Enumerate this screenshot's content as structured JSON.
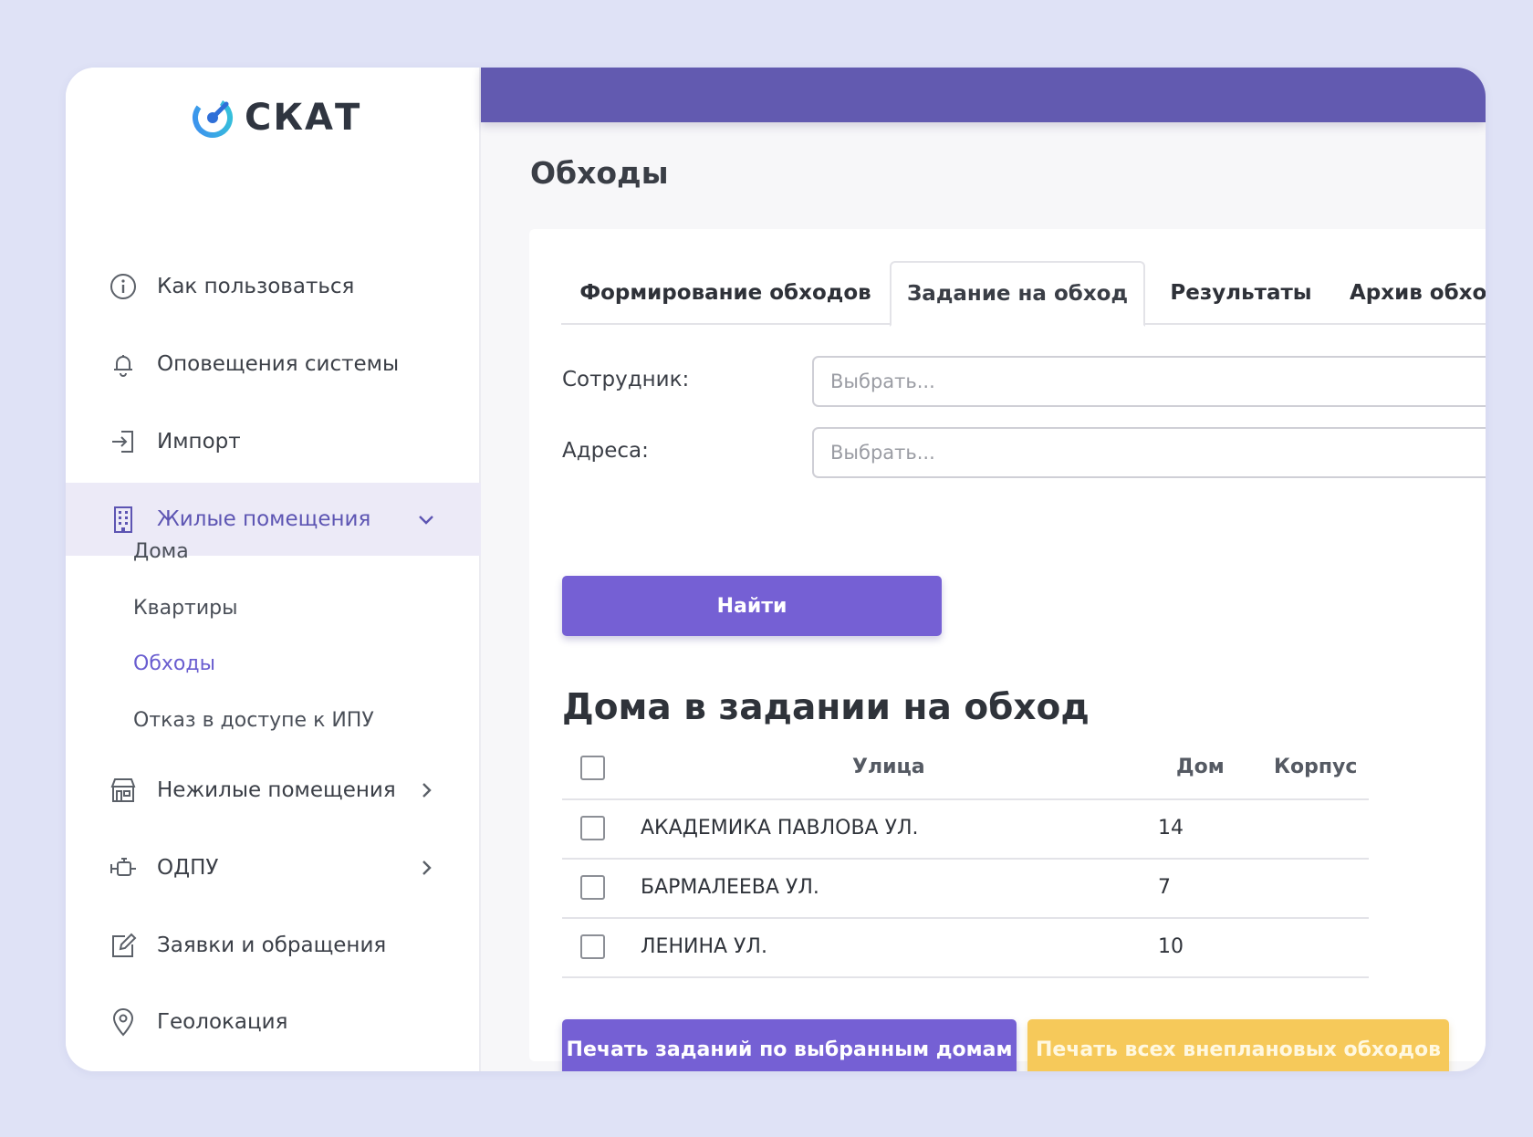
{
  "app": {
    "logo_text": "СКАТ"
  },
  "sidebar": {
    "items": [
      {
        "label": "Как пользоваться"
      },
      {
        "label": "Оповещения системы"
      },
      {
        "label": "Импорт"
      },
      {
        "label": "Жилые помещения"
      },
      {
        "label": "Нежилые помещения"
      },
      {
        "label": "ОДПУ"
      },
      {
        "label": "Заявки и обращения"
      },
      {
        "label": "Геолокация"
      }
    ],
    "subitems": [
      {
        "label": "Дома"
      },
      {
        "label": "Квартиры"
      },
      {
        "label": "Обходы"
      },
      {
        "label": "Отказ в доступе к ИПУ"
      }
    ]
  },
  "page": {
    "title": "Обходы"
  },
  "tabs": [
    {
      "label": "Формирование обходов"
    },
    {
      "label": "Задание на обход"
    },
    {
      "label": "Результаты"
    },
    {
      "label": "Архив обхо,"
    }
  ],
  "form": {
    "employee_label": "Сотрудник:",
    "employee_placeholder": "Выбрать...",
    "address_label": "Адреса:",
    "address_placeholder": "Выбрать...",
    "find_button": "Найти"
  },
  "section": {
    "title": "Дома в задании на обход"
  },
  "table": {
    "columns": [
      "Улица",
      "Дом",
      "Корпус"
    ],
    "rows": [
      {
        "street": "АКАДЕМИКА ПАВЛОВА УЛ.",
        "house": "14",
        "building": ""
      },
      {
        "street": "БАРМАЛЕЕВА УЛ.",
        "house": "7",
        "building": ""
      },
      {
        "street": "ЛЕНИНА УЛ.",
        "house": "10",
        "building": ""
      }
    ]
  },
  "actions": {
    "print_selected": "Печать заданий по выбранным домам",
    "print_all": "Печать всех внеплановых обходов"
  },
  "colors": {
    "accent": "#7560d4",
    "topbar": "#625ab0",
    "warning": "#f6c95a",
    "background": "#dfe2f6"
  }
}
